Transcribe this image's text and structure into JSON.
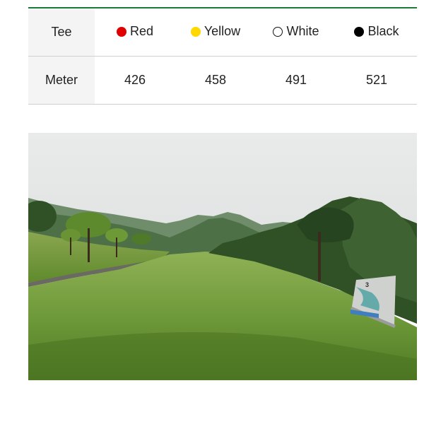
{
  "table": {
    "row_headers": {
      "tee": "Tee",
      "meter": "Meter"
    },
    "tees": [
      {
        "name": "Red",
        "color": "#e00000",
        "border": "#e00000",
        "meter": "426"
      },
      {
        "name": "Yellow",
        "color": "#ffd800",
        "border": "#ffd800",
        "meter": "458"
      },
      {
        "name": "White",
        "color": "#ffffff",
        "border": "#111111",
        "meter": "491"
      },
      {
        "name": "Black",
        "color": "#000000",
        "border": "#000000",
        "meter": "521"
      }
    ],
    "accent_color": "#1e7a3c"
  },
  "photo": {
    "subject": "golf-course-tee-box-photo",
    "sign_hole_number": "3"
  }
}
